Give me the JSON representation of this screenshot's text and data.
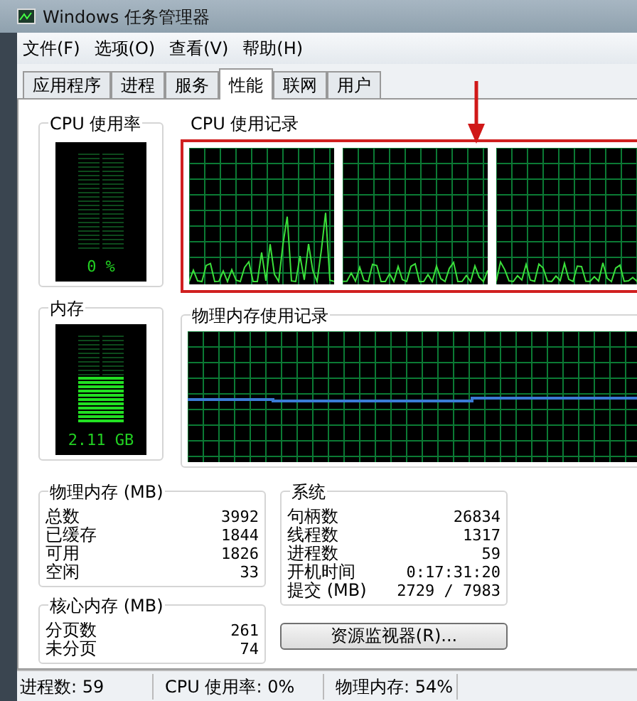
{
  "window": {
    "title": "Windows 任务管理器"
  },
  "menu": [
    "文件(F)",
    "选项(O)",
    "查看(V)",
    "帮助(H)"
  ],
  "tabs": [
    {
      "label": "应用程序",
      "selected": false
    },
    {
      "label": "进程",
      "selected": false
    },
    {
      "label": "服务",
      "selected": false
    },
    {
      "label": "性能",
      "selected": true
    },
    {
      "label": "联网",
      "selected": false
    },
    {
      "label": "用户",
      "selected": false
    }
  ],
  "cpu_usage": {
    "title": "CPU 使用率",
    "level": 0,
    "reading": "0 %"
  },
  "cpu_history": {
    "title": "CPU 使用记录",
    "highlighted": true
  },
  "memory": {
    "title": "内存",
    "level": 0.54,
    "reading": "2.11 GB"
  },
  "memory_history": {
    "title": "物理内存使用记录"
  },
  "physical_memory": {
    "title": "物理内存 (MB)",
    "rows": [
      {
        "label": "总数",
        "value": "3992"
      },
      {
        "label": "已缓存",
        "value": "1844"
      },
      {
        "label": "可用",
        "value": "1826"
      },
      {
        "label": "空闲",
        "value": "33"
      }
    ]
  },
  "kernel_memory": {
    "title": "核心内存 (MB)",
    "rows": [
      {
        "label": "分页数",
        "value": "261"
      },
      {
        "label": "未分页",
        "value": "74"
      }
    ]
  },
  "system": {
    "title": "系统",
    "rows": [
      {
        "label": "句柄数",
        "value": "26834"
      },
      {
        "label": "线程数",
        "value": "1317"
      },
      {
        "label": "进程数",
        "value": "59"
      },
      {
        "label": "开机时间",
        "value": "0:17:31:20"
      },
      {
        "label": "提交 (MB)",
        "value": "2729 / 7983"
      }
    ]
  },
  "resource_monitor_button": "资源监视器(R)...",
  "status_bar": [
    "进程数: 59",
    "CPU 使用率: 0%",
    "物理内存: 54%"
  ]
}
